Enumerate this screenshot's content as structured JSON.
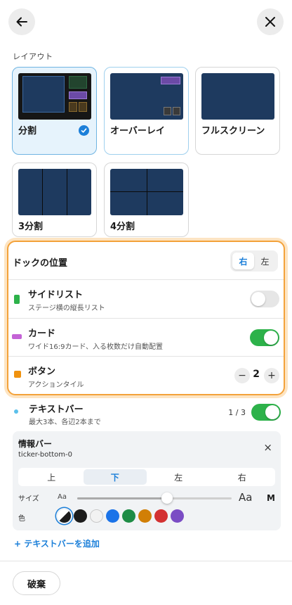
{
  "header": {
    "back_icon": "arrow-left-icon",
    "close_icon": "close-icon"
  },
  "layout_section": {
    "label": "レイアウト",
    "cards": [
      {
        "id": "split",
        "label": "分割",
        "selected": true
      },
      {
        "id": "overlay",
        "label": "オーバーレイ",
        "selected": false
      },
      {
        "id": "fullscreen",
        "label": "フルスクリーン",
        "selected": false
      },
      {
        "id": "split3",
        "label": "3分割",
        "selected": false
      },
      {
        "id": "split4",
        "label": "4分割",
        "selected": false
      }
    ]
  },
  "dock": {
    "title": "ドックの位置",
    "options": [
      "右",
      "左"
    ],
    "selected": "右",
    "rows": [
      {
        "id": "side-list",
        "title": "サイドリスト",
        "subtitle": "ステージ横の縦長リスト",
        "color": "#2db24a",
        "enabled": false
      },
      {
        "id": "card",
        "title": "カード",
        "subtitle": "ワイド16:9カード、入る枚数だけ自動配置",
        "color": "#c463d6",
        "enabled": true
      },
      {
        "id": "button",
        "title": "ボタン",
        "subtitle": "アクションタイル",
        "color": "#f0920f",
        "count": "2",
        "minus": "−",
        "plus": "+"
      }
    ]
  },
  "text_bar": {
    "title": "テキストバー",
    "subtitle": "最大3本、各辺2本まで",
    "count": "1 / 3",
    "color": "#5bc0eb",
    "enabled": true
  },
  "info_bar": {
    "title": "情報バー",
    "id_text": "ticker-bottom-0",
    "close": "×",
    "directions": [
      "上",
      "下",
      "左",
      "右"
    ],
    "selected_direction": "下",
    "size_label": "サイズ",
    "size_small": "Aa",
    "size_large": "Aa",
    "size_value": "M",
    "size_level": 0.58,
    "color_label": "色",
    "colors": [
      "auto",
      "#1c1c1c",
      "#f2f2f2",
      "#1a73e8",
      "#1e8c45",
      "#d17f06",
      "#d33131",
      "#7a4cc4"
    ]
  },
  "add_text_bar": "+ テキストバーを追加",
  "footer": {
    "discard": "破棄"
  }
}
